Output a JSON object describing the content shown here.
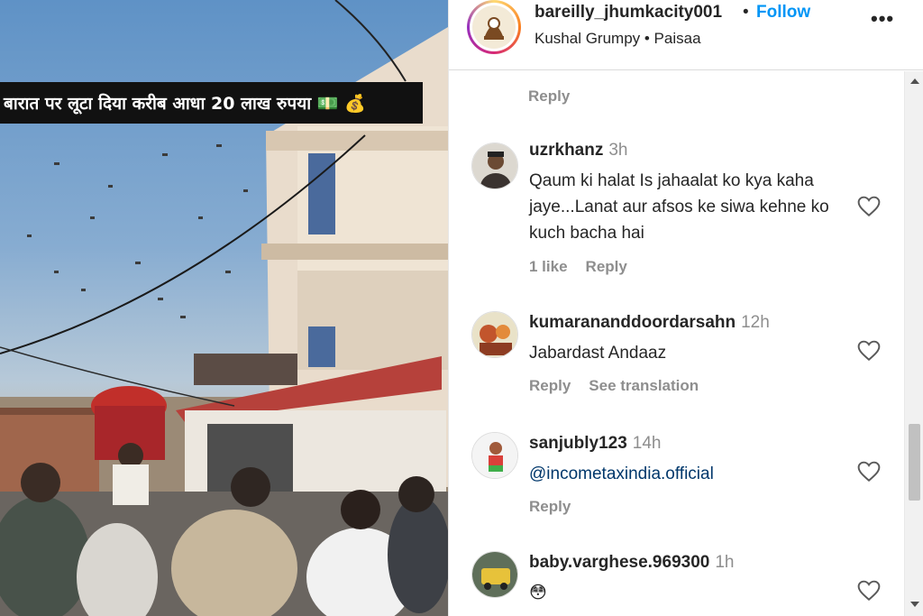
{
  "media": {
    "caption": "बारात पर लूटा दिया करीब आधा 20 लाख रुपया 💵 💰"
  },
  "post_header": {
    "username": "bareilly_jhumkacity001",
    "separator": "•",
    "follow_label": "Follow",
    "audio": "Kushal Grumpy • Paisaa",
    "more_icon": "more-horizontal-icon",
    "more_label": "•••"
  },
  "comments": {
    "top_reply_label": "Reply",
    "items": [
      {
        "username": "uzrkhanz",
        "time": "3h",
        "text": "Qaum ki halat Is jahaalat ko kya kaha jaye...Lanat aur afsos ke siwa kehne ko kuch bacha hai",
        "likes": "1 like",
        "reply": "Reply"
      },
      {
        "username": "kumarananddoordarsahn",
        "time": "12h",
        "text": "Jabardast Andaaz",
        "reply": "Reply",
        "translate": "See translation"
      },
      {
        "username": "sanjubly123",
        "time": "14h",
        "text": "@incometaxindia.official",
        "reply": "Reply"
      },
      {
        "username": "baby.varghese.969300",
        "time": "1h",
        "text": "😳"
      }
    ]
  },
  "colors": {
    "accent_blue": "#0095f6",
    "mention_blue": "#00376b",
    "secondary_text": "#8e8e8e"
  }
}
